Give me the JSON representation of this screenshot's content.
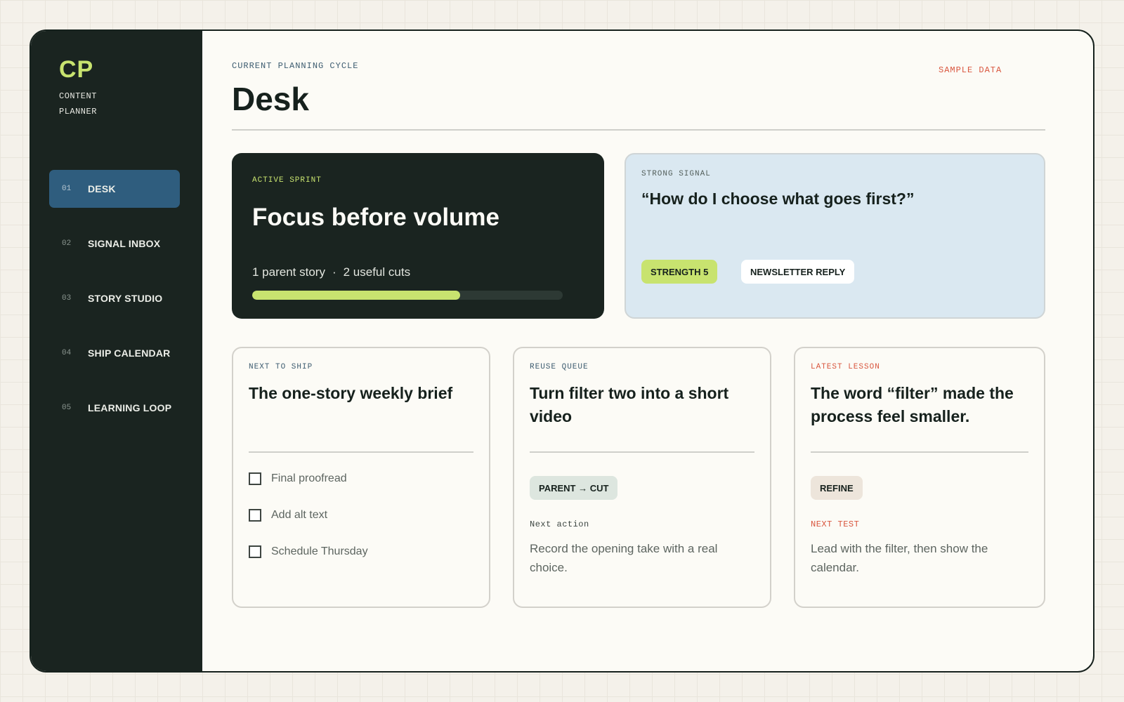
{
  "sidebar": {
    "logo": "CP",
    "logo_sub_1": "CONTENT",
    "logo_sub_2": "PLANNER",
    "items": [
      {
        "num": "01",
        "label": "DESK"
      },
      {
        "num": "02",
        "label": "SIGNAL INBOX"
      },
      {
        "num": "03",
        "label": "STORY STUDIO"
      },
      {
        "num": "04",
        "label": "SHIP CALENDAR"
      },
      {
        "num": "05",
        "label": "LEARNING LOOP"
      }
    ]
  },
  "header": {
    "eyebrow": "CURRENT PLANNING CYCLE",
    "title": "Desk",
    "sample_label": "SAMPLE DATA"
  },
  "sprint": {
    "label": "ACTIVE SPRINT",
    "heading": "Focus before volume",
    "meta_left": "1 parent story",
    "meta_sep": "·",
    "meta_right": "2 useful cuts",
    "progress": 0.67
  },
  "signal": {
    "label": "STRONG SIGNAL",
    "quote": "“How do I choose what goes first?”",
    "chip_strength": "STRENGTH 5",
    "chip_source": "NEWSLETTER REPLY"
  },
  "cards": {
    "ship": {
      "label": "NEXT TO SHIP",
      "heading": "The one-story weekly brief",
      "checklist": [
        "Final proofread",
        "Add alt text",
        "Schedule Thursday"
      ]
    },
    "reuse": {
      "label": "REUSE QUEUE",
      "heading": "Turn filter two into a short video",
      "tag": "PARENT → CUT",
      "sublabel": "Next action",
      "body": "Record the opening take with a real choice."
    },
    "lesson": {
      "label": "LATEST LESSON",
      "heading": "The word “filter” made the process feel smaller.",
      "tag": "REFINE",
      "sublabel": "NEXT TEST",
      "body": "Lead with the filter, then show the calendar."
    }
  },
  "colors": {
    "sidebar_bg": "#1a2420",
    "accent_lime": "#c8e36f",
    "active_nav": "#2f5d7e",
    "signal_bg": "#dae8f1",
    "warning_red": "#d9573f"
  }
}
